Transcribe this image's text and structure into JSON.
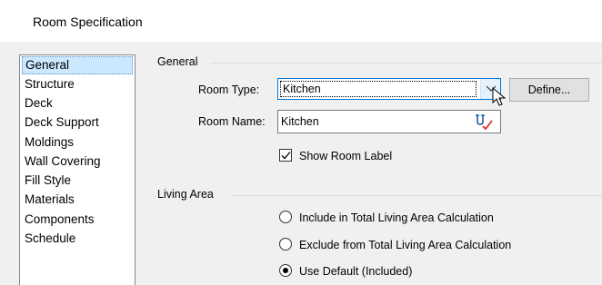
{
  "window": {
    "title": "Room Specification"
  },
  "categories": [
    {
      "label": "General",
      "selected": true
    },
    {
      "label": "Structure",
      "selected": false
    },
    {
      "label": "Deck",
      "selected": false
    },
    {
      "label": "Deck Support",
      "selected": false
    },
    {
      "label": "Moldings",
      "selected": false
    },
    {
      "label": "Wall Covering",
      "selected": false
    },
    {
      "label": "Fill Style",
      "selected": false
    },
    {
      "label": "Materials",
      "selected": false
    },
    {
      "label": "Components",
      "selected": false
    },
    {
      "label": "Schedule",
      "selected": false
    }
  ],
  "general": {
    "header": "General",
    "room_type_label": "Room Type:",
    "room_type_value": "Kitchen",
    "define_label": "Define...",
    "room_name_label": "Room Name:",
    "room_name_value": "Kitchen",
    "show_label_text": "Show Room Label",
    "show_label_checked": true
  },
  "living_area": {
    "header": "Living Area",
    "options": [
      {
        "label": "Include in Total Living Area Calculation",
        "selected": false
      },
      {
        "label": "Exclude from Total Living Area Calculation",
        "selected": false
      },
      {
        "label": "Use Default (Included)",
        "selected": true
      }
    ]
  },
  "colors": {
    "selection_bg": "#cce8ff",
    "focus_border": "#0078d7",
    "dialog_bg": "#f0f0f0"
  }
}
